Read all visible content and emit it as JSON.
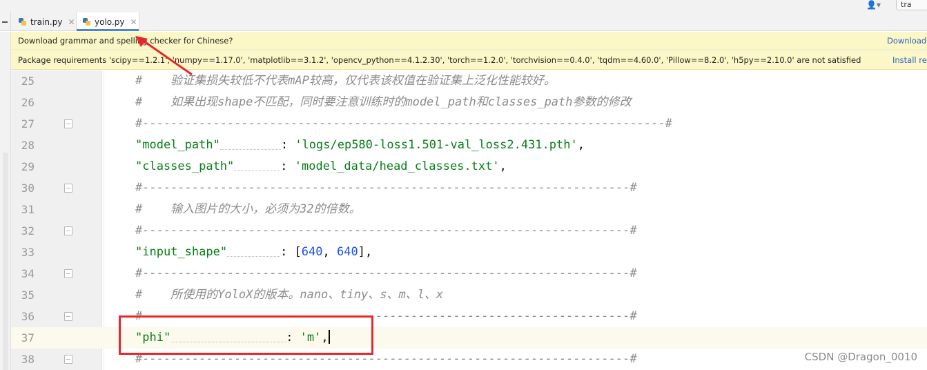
{
  "tabs": [
    {
      "label": "train.py",
      "active": false
    },
    {
      "label": "yolo.py",
      "active": true
    }
  ],
  "top_right_tab": "tra",
  "banners": {
    "grammar": {
      "text": "Download grammar and spelling checker for Chinese?",
      "action": "Download"
    },
    "requirements": {
      "text": "Package requirements 'scipy==1.2.1', 'numpy==1.17.0', 'matplotlib==3.1.2', 'opencv_python==4.1.2.30', 'torch==1.2.0', 'torchvision==0.4.0', 'tqdm==4.60.0', 'Pillow==8.2.0', 'h5py==2.10.0' are not satisfied",
      "action": "Install re"
    }
  },
  "editor": {
    "current_line": "37",
    "lines": [
      {
        "num": "25",
        "comment": "#    验证集损失较低不代表mAP较高，仅代表该权值在验证集上泛化性能较好。"
      },
      {
        "num": "26",
        "comment": "#    如果出现shape不匹配，同时要注意训练时的model_path和classes_path参数的修改"
      },
      {
        "num": "27",
        "comment": "#--------------------------------------------------------------------------#"
      },
      {
        "num": "28",
        "key": "\"model_path\"",
        "colon": ": ",
        "value": "'logs/ep580-loss1.501-val_loss2.431.pth'",
        "tail": ","
      },
      {
        "num": "29",
        "key": "\"classes_path\"",
        "colon": ": ",
        "value": "'model_data/head_classes.txt'",
        "tail": ","
      },
      {
        "num": "30",
        "comment": "#---------------------------------------------------------------------#"
      },
      {
        "num": "31",
        "comment": "#    输入图片的大小，必须为32的倍数。"
      },
      {
        "num": "32",
        "comment": "#---------------------------------------------------------------------#"
      },
      {
        "num": "33",
        "key": "\"input_shape\"",
        "colon": ": ",
        "list_open": "[",
        "n1": "640",
        "sep": ", ",
        "n2": "640",
        "list_close": "],"
      },
      {
        "num": "34",
        "comment": "#---------------------------------------------------------------------#"
      },
      {
        "num": "35",
        "comment": "#    所使用的YoloX的版本。nano、tiny、s、m、l、x"
      },
      {
        "num": "36",
        "comment": "#---------------------------------------------------------------------#"
      },
      {
        "num": "37",
        "key": "\"phi\"",
        "colon": ": ",
        "value": "'m'",
        "tail": ","
      },
      {
        "num": "38",
        "comment": "#---------------------------------------------------------------------#"
      }
    ]
  },
  "watermark": "CSDN @Dragon_0010",
  "colors": {
    "annotation_red": "#e8262b",
    "string_green": "#067d17",
    "number_blue": "#1750eb",
    "comment_gray": "#8c8c8c"
  }
}
